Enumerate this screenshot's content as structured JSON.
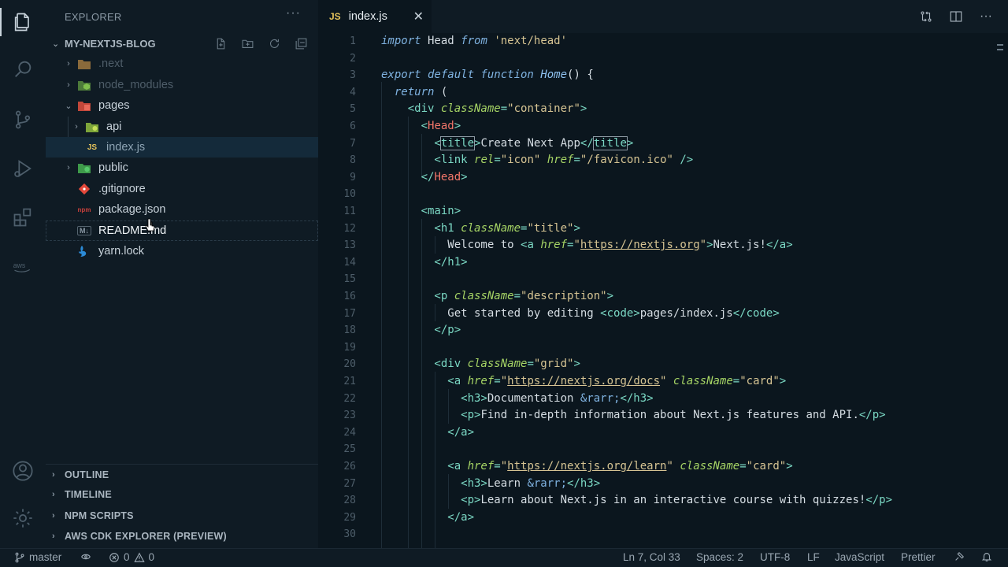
{
  "sidebar": {
    "title": "EXPLORER",
    "more": "···",
    "project": "MY-NEXTJS-BLOG",
    "tree": [
      {
        "label": ".next",
        "icon": "folder-icon"
      },
      {
        "label": "node_modules",
        "icon": "node-folder-icon"
      },
      {
        "label": "pages",
        "icon": "pages-folder-icon"
      },
      {
        "label": "api",
        "icon": "api-folder-icon"
      },
      {
        "label": "index.js",
        "icon": "js-file-icon",
        "badge": "JS"
      },
      {
        "label": "public",
        "icon": "public-folder-icon"
      },
      {
        "label": ".gitignore",
        "icon": "git-icon"
      },
      {
        "label": "package.json",
        "icon": "npm-icon",
        "badge": "npm"
      },
      {
        "label": "README.md",
        "icon": "markdown-icon",
        "badge": "M↓"
      },
      {
        "label": "yarn.lock",
        "icon": "yarn-icon"
      }
    ],
    "sections": [
      "OUTLINE",
      "TIMELINE",
      "NPM SCRIPTS",
      "AWS CDK EXPLORER (PREVIEW)"
    ]
  },
  "tab": {
    "badge": "JS",
    "label": "index.js",
    "close": "✕"
  },
  "editor": {
    "line_numbers": [
      "1",
      "2",
      "3",
      "4",
      "5",
      "6",
      "7",
      "8",
      "9",
      "10",
      "11",
      "12",
      "13",
      "14",
      "15",
      "16",
      "17",
      "18",
      "19",
      "20",
      "21",
      "22",
      "23",
      "24",
      "25",
      "26",
      "27",
      "28",
      "29",
      "30"
    ]
  },
  "code": {
    "l1": {
      "a": "import",
      "b": " Head ",
      "c": "from",
      "d": " ",
      "e": "'next/head'"
    },
    "l3": {
      "a": "export default function",
      "b": " ",
      "c": "Home",
      "d": "() {"
    },
    "l4": {
      "a": "  ",
      "b": "return",
      "c": " ("
    },
    "l5": {
      "a": "    <div ",
      "b": "className",
      "c": "=",
      "d": "\"container\"",
      "e": ">"
    },
    "l6": {
      "a": "      <",
      "b": "Head",
      "c": ">"
    },
    "l7": {
      "a": "        <",
      "b": "title",
      "c": ">",
      "d": "Create Next App",
      "e": "</",
      "f": "title",
      "g": ">"
    },
    "l8": {
      "a": "        <link ",
      "b": "rel",
      "c": "=",
      "d": "\"icon\"",
      "e": " ",
      "f": "href",
      "g": "=",
      "h": "\"/favicon.ico\"",
      "i": " />"
    },
    "l9": {
      "a": "      </",
      "b": "Head",
      "c": ">"
    },
    "l11": {
      "a": "      <main>"
    },
    "l12": {
      "a": "        <h1 ",
      "b": "className",
      "c": "=",
      "d": "\"title\"",
      "e": ">"
    },
    "l13": {
      "a": "          Welcome to ",
      "b": "<a ",
      "c": "href",
      "d": "=",
      "e": "\"",
      "f": "https://nextjs.org",
      "g": "\"",
      "h": ">",
      "i": "Next.js!",
      "j": "</a>"
    },
    "l14": {
      "a": "        </h1>"
    },
    "l16": {
      "a": "        <p ",
      "b": "className",
      "c": "=",
      "d": "\"description\"",
      "e": ">"
    },
    "l17": {
      "a": "          Get started by editing ",
      "b": "<code>",
      "c": "pages/index.js",
      "d": "</code>"
    },
    "l18": {
      "a": "        </p>"
    },
    "l20": {
      "a": "        <div ",
      "b": "className",
      "c": "=",
      "d": "\"grid\"",
      "e": ">"
    },
    "l21": {
      "a": "          <a ",
      "b": "href",
      "c": "=",
      "d": "\"",
      "e": "https://nextjs.org/docs",
      "f": "\"",
      "g": " ",
      "h": "className",
      "i": "=",
      "j": "\"card\"",
      "k": ">"
    },
    "l22": {
      "a": "            <h3>",
      "b": "Documentation ",
      "c": "&rarr;",
      "d": "</h3>"
    },
    "l23": {
      "a": "            <p>",
      "b": "Find in-depth information about Next.js features and API.",
      "c": "</p>"
    },
    "l24": {
      "a": "          </a>"
    },
    "l26": {
      "a": "          <a ",
      "b": "href",
      "c": "=",
      "d": "\"",
      "e": "https://nextjs.org/learn",
      "f": "\"",
      "g": " ",
      "h": "className",
      "i": "=",
      "j": "\"card\"",
      "k": ">"
    },
    "l27": {
      "a": "            <h3>",
      "b": "Learn ",
      "c": "&rarr;",
      "d": "</h3>"
    },
    "l28": {
      "a": "            <p>",
      "b": "Learn about Next.js in an interactive course with quizzes!",
      "c": "</p>"
    },
    "l29": {
      "a": "          </a>"
    }
  },
  "status": {
    "branch": "master",
    "errors": "0",
    "warnings": "0",
    "position": "Ln 7, Col 33",
    "spaces": "Spaces: 2",
    "encoding": "UTF-8",
    "eol": "LF",
    "language": "JavaScript",
    "formatter": "Prettier"
  },
  "colors": {
    "background": "#0f1b24",
    "editor_bg": "#0b161e",
    "selection": "#142a3a",
    "js_badge": "#e5c25a"
  }
}
